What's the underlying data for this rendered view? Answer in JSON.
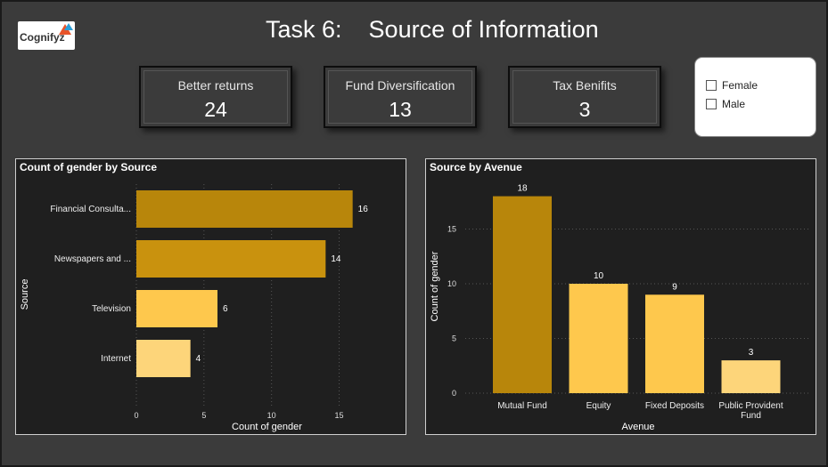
{
  "logo": {
    "name": "Cognifyz"
  },
  "title": "Task 6:    Source of Information",
  "kpis": [
    {
      "label": "Better returns",
      "value": "24"
    },
    {
      "label": "Fund Diversification",
      "value": "13"
    },
    {
      "label": "Tax Benifits",
      "value": "3"
    }
  ],
  "slicer": {
    "options": [
      "Female",
      "Male"
    ]
  },
  "colors": {
    "dark_gold": "#b8860b",
    "mid_gold": "#c9920e",
    "light_gold": "#fec84d",
    "pale_gold": "#fdd57a"
  },
  "chart_data": [
    {
      "type": "bar",
      "orientation": "horizontal",
      "title": "Count of gender by Source",
      "xlabel": "Count of gender",
      "ylabel": "Source",
      "categories": [
        "Financial Consulta...",
        "Newspapers and ...",
        "Television",
        "Internet"
      ],
      "values": [
        16,
        14,
        6,
        4
      ],
      "xlim": [
        0,
        18
      ],
      "xticks": [
        0,
        5,
        10,
        15
      ],
      "bar_colors": [
        "#b8860b",
        "#c9920e",
        "#fec84d",
        "#fdd57a"
      ]
    },
    {
      "type": "bar",
      "orientation": "vertical",
      "title": "Source by Avenue",
      "xlabel": "Avenue",
      "ylabel": "Count of gender",
      "categories": [
        "Mutual Fund",
        "Equity",
        "Fixed Deposits",
        "Public Provident Fund"
      ],
      "values": [
        18,
        10,
        9,
        3
      ],
      "ylim": [
        0,
        20
      ],
      "yticks": [
        0,
        5,
        10,
        15
      ],
      "bar_colors": [
        "#b8860b",
        "#fec84d",
        "#fec84d",
        "#fdd57a"
      ]
    }
  ]
}
